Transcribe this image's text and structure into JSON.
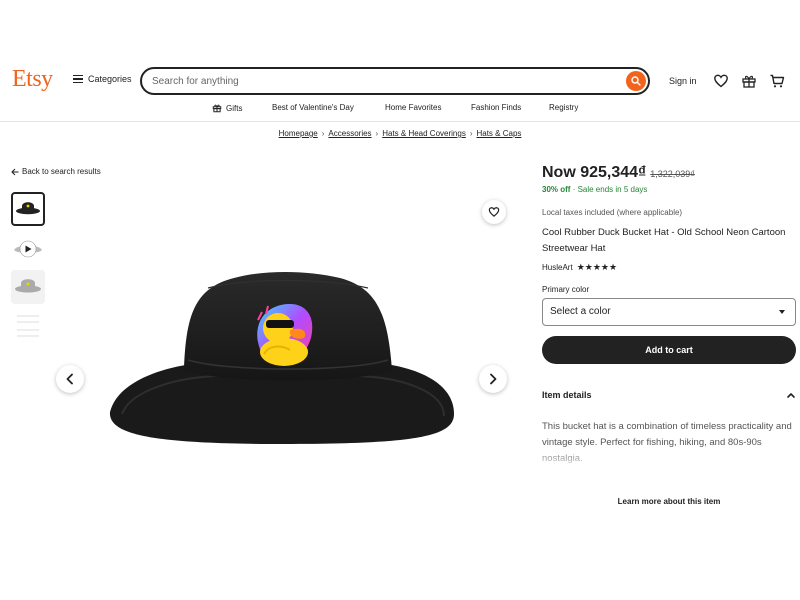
{
  "header": {
    "logo": "Etsy",
    "categories_label": "Categories",
    "search_placeholder": "Search for anything",
    "signin_label": "Sign in"
  },
  "subnav": {
    "items": [
      "Gifts",
      "Best of Valentine's Day",
      "Home Favorites",
      "Fashion Finds",
      "Registry"
    ]
  },
  "breadcrumb": [
    "Homepage",
    "Accessories",
    "Hats & Head Coverings",
    "Hats & Caps"
  ],
  "back_label": "Back to search results",
  "product": {
    "price_now": "Now 925,344₫",
    "price_old": "1,322,039₫",
    "discount": "30% off",
    "sale_text": "· Sale ends in 5 days",
    "taxes": "Local taxes included (where applicable)",
    "title": "Cool Rubber Duck Bucket Hat - Old School Neon Cartoon Streetwear Hat",
    "shop": "HusleArt",
    "stars": "★★★★★",
    "primary_color_label": "Primary color",
    "select_value": "Select a color",
    "add_to_cart": "Add to cart",
    "item_details_label": "Item details",
    "details_text": "This bucket hat is a combination of timeless practicality and vintage style. Perfect for fishing, hiking, and 80s-90s nostalgia.",
    "learn_more": "Learn more about this item"
  },
  "colors": {
    "brand": "#f1641e",
    "sale_green": "#258635",
    "button_dark": "#222222"
  },
  "icons": [
    "search-icon",
    "heart-icon",
    "gift-icon",
    "cart-icon",
    "chevron-left-icon",
    "chevron-right-icon",
    "chevron-up-icon",
    "play-icon"
  ]
}
